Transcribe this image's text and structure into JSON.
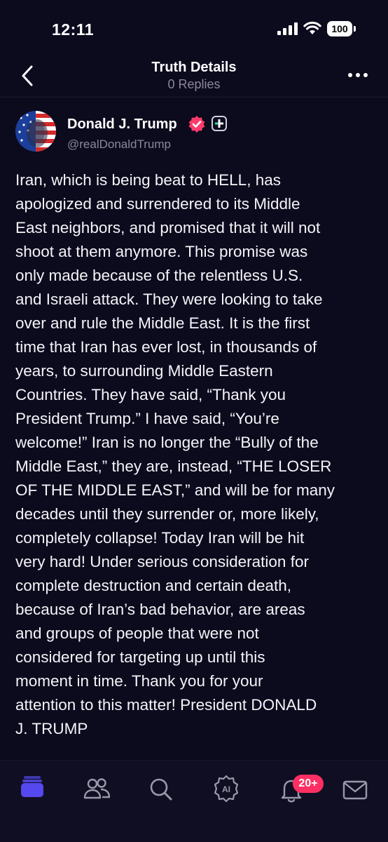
{
  "status_bar": {
    "time": "12:11",
    "battery": "100"
  },
  "header": {
    "title": "Truth Details",
    "subtitle": "0 Replies"
  },
  "post": {
    "author_name": "Donald J. Trump",
    "author_handle": "@realDonaldTrump",
    "body": "Iran, which is being beat to HELL, has\napologized and surrendered to its Middle\nEast neighbors, and promised that it will not\nshoot at them anymore. This promise was\nonly made because of the relentless U.S.\nand Israeli attack. They were looking to take\nover and rule the Middle East. It is the first\ntime that Iran has ever lost, in thousands of\nyears, to surrounding Middle Eastern\nCountries. They have said, “Thank you\nPresident Trump.” I have said, “You’re\nwelcome!” Iran is no longer the “Bully of the\nMiddle East,” they are, instead, “THE LOSER\nOF THE MIDDLE EAST,” and will be for many\ndecades until they surrender or, more likely,\ncompletely collapse! Today Iran will be hit\nvery hard! Under serious consideration for\ncomplete destruction and certain death,\nbecause of Iran’s bad behavior, are areas\nand groups of people that were not\nconsidered for targeting up until this\nmoment in time. Thank you for your\nattention to this matter! President DONALD\nJ. TRUMP"
  },
  "tab_bar": {
    "tabs": [
      {
        "icon": "home-feed-icon",
        "active": true
      },
      {
        "icon": "groups-icon",
        "active": false
      },
      {
        "icon": "search-icon",
        "active": false
      },
      {
        "icon": "ai-icon",
        "active": false
      },
      {
        "icon": "bell-icon",
        "active": false
      },
      {
        "icon": "mail-icon",
        "active": false
      }
    ],
    "notification_badge": "20+"
  },
  "colors": {
    "background": "#0c0a1d",
    "accent": "#5448ee",
    "verified": "#ff3b6b",
    "badge": "#ff2f63",
    "muted": "#8a8898"
  }
}
